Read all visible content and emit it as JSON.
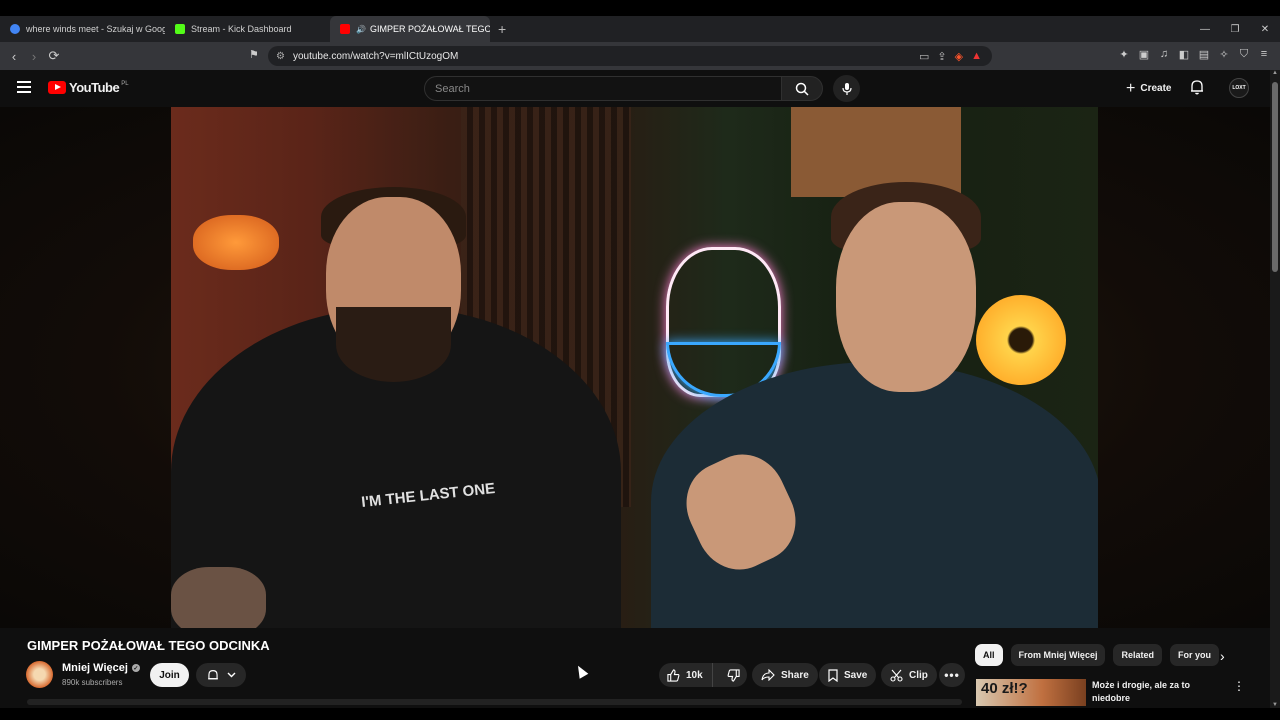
{
  "browser": {
    "tabs": [
      {
        "title": "where winds meet - Szukaj w Google",
        "favicon_color": "#4285f4"
      },
      {
        "title": "Stream - Kick Dashboard",
        "favicon_color": "#53fc18"
      },
      {
        "title": "GIMPER POŻAŁOWAŁ TEGO O",
        "favicon_color": "#ff0000",
        "active": true
      }
    ],
    "url": "youtube.com/watch?v=mlICtUzogOM"
  },
  "youtube": {
    "logo_text": "YouTube",
    "country_code": "PL",
    "search_placeholder": "Search",
    "create_label": "Create",
    "avatar_text": "LOXT"
  },
  "video": {
    "title": "GIMPER POŻAŁOWAŁ TEGO ODCINKA",
    "shirt_text": "I'M THE LAST ONE",
    "channel_name": "Mniej Więcej",
    "subscribers": "890k subscribers",
    "join_label": "Join",
    "like_count": "10k",
    "share_label": "Share",
    "save_label": "Save",
    "clip_label": "Clip"
  },
  "sidebar": {
    "chips": [
      "All",
      "From Mniej Więcej",
      "Related",
      "For you"
    ],
    "selected_chip": "All",
    "reco": {
      "thumb_text": "40 zł!?",
      "title": "Może i drogie, ale za to niedobre"
    }
  },
  "colors": {
    "accent": "#ff0000",
    "background": "#0f0f0f",
    "pill": "#272727"
  }
}
